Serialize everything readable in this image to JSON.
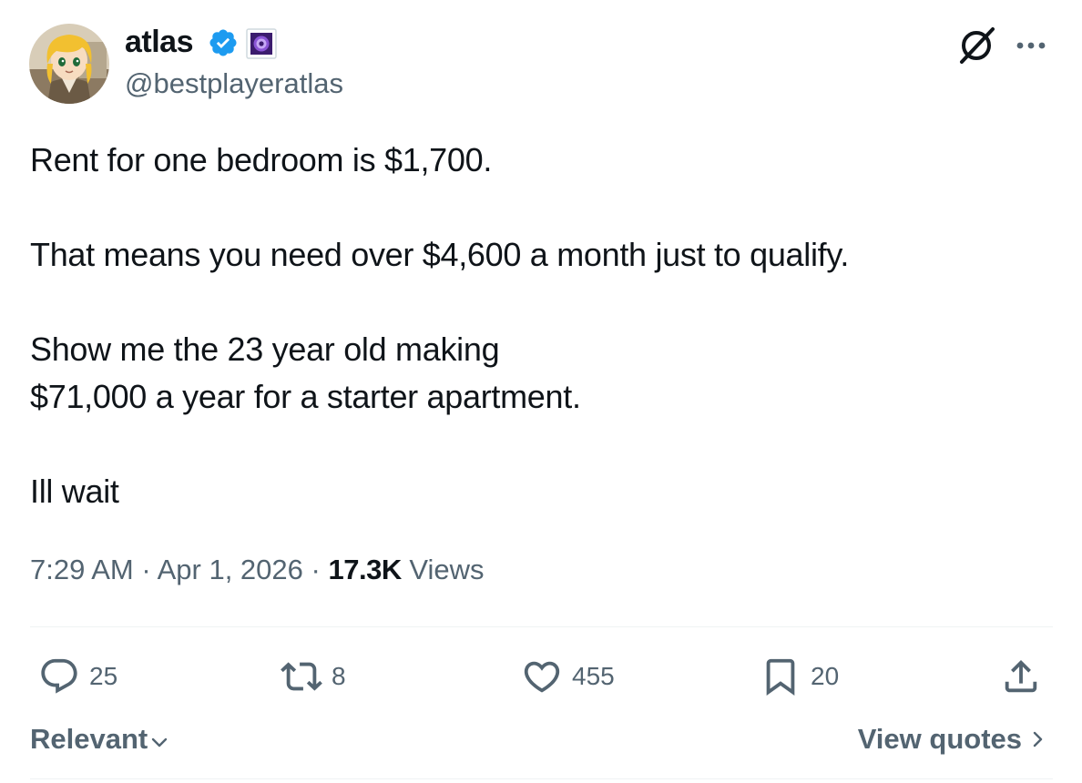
{
  "author": {
    "display_name": "atlas",
    "handle": "@bestplayeratlas",
    "verified": true,
    "avatar_icon": "anime-character-avatar",
    "badge_icon": "affiliate-badge-icon"
  },
  "tweet": {
    "paragraphs": [
      "Rent for one bedroom is $1,700.",
      "That means you need over $4,600 a month just to qualify.",
      "Show me the 23 year old making",
      "$71,000 a year for a starter apartment.",
      "Ill wait"
    ],
    "time": "7:29 AM",
    "separator": "·",
    "date": "Apr 1, 2026",
    "views_count": "17.3K",
    "views_label": "Views"
  },
  "actions": {
    "replies": "25",
    "reposts": "8",
    "likes": "455",
    "bookmarks": "20"
  },
  "footer": {
    "sort_label": "Relevant",
    "quotes_label": "View quotes"
  },
  "colors": {
    "text": "#0f1419",
    "secondary": "#536471",
    "verified_blue": "#1d9bf0",
    "divider": "#eff3f4"
  }
}
